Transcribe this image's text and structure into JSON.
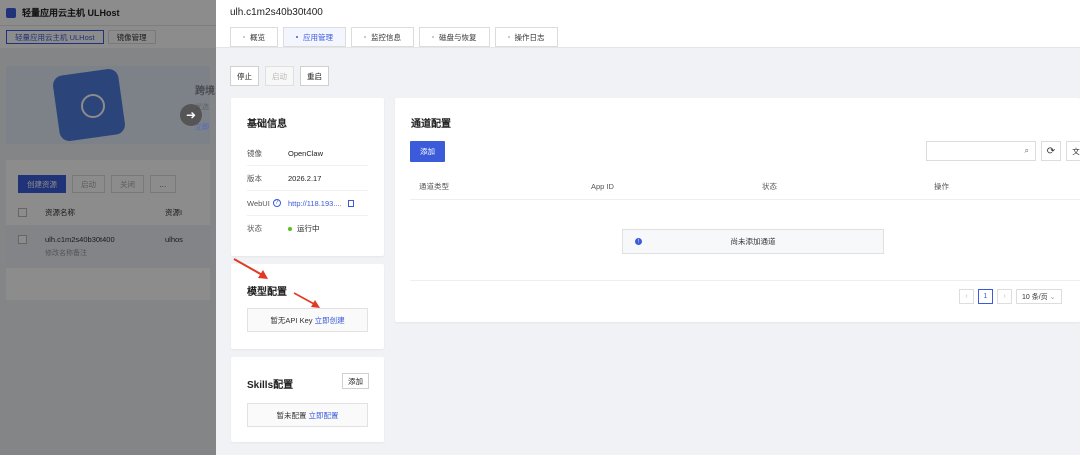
{
  "background": {
    "app_title": "轻量应用云主机 ULHost",
    "tabs": [
      "轻量应用云主机 ULHost",
      "镜像管理"
    ],
    "banner": {
      "title": "跨境",
      "subtitle": "优选",
      "link": "立即"
    },
    "actions": [
      "创建资源",
      "启动",
      "关闭",
      "…"
    ],
    "table": {
      "col_name": "资源名称",
      "col_id": "资源I"
    },
    "row": {
      "name": "ulh.c1m2s40b30t400",
      "sub": "修改名称备注",
      "id": "ulhos"
    }
  },
  "drawer": {
    "title": "ulh.c1m2s40b30t400",
    "tabs": [
      "概览",
      "应用管理",
      "监控信息",
      "磁盘与恢复",
      "操作日志"
    ],
    "active_tab": 1,
    "ops": {
      "stop": "停止",
      "start": "启动",
      "restart": "重启"
    },
    "basic": {
      "title": "基础信息",
      "rows": [
        {
          "key": "镜像",
          "value": "OpenClaw"
        },
        {
          "key": "版本",
          "value": "2026.2.17"
        },
        {
          "key": "WebUI",
          "value": "http://118.193...."
        },
        {
          "key": "状态",
          "value": "运行中"
        }
      ]
    },
    "model": {
      "title": "模型配置",
      "empty_text": "暂无API Key",
      "create_link": "立即创建"
    },
    "skills": {
      "title": "Skills配置",
      "add": "添加",
      "empty_text": "暂未配置",
      "config_link": "立即配置"
    },
    "channel": {
      "title": "通道配置",
      "add": "添加",
      "search_placeholder": "",
      "text_btn": "文",
      "columns": [
        "通道类型",
        "App ID",
        "状态",
        "操作"
      ],
      "empty_text": "尚未添加通道",
      "pager": {
        "page": "1",
        "page_size": "10 条/页"
      }
    }
  }
}
